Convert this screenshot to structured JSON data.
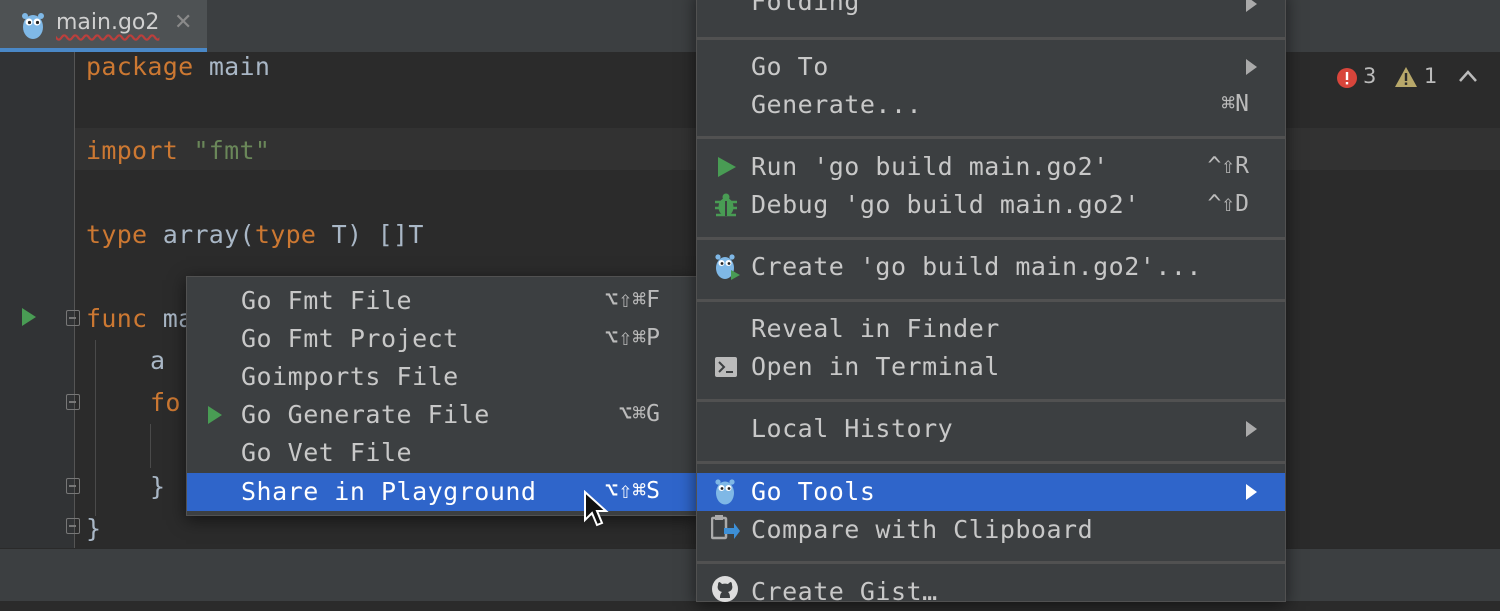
{
  "tab": {
    "filename": "main.go2",
    "close_glyph": "✕"
  },
  "editor": {
    "lines": {
      "l1_kw": "package",
      "l1_rest": " main",
      "l2_kw": "import",
      "l2_str": " \"fmt\"",
      "l3_kw1": "type",
      "l3_mid": " array(",
      "l3_kw2": "type",
      "l3_rest": " T) []T",
      "l4_kw": "func",
      "l4_rest": " ma",
      "l5": "a",
      "l6_kw": "fo",
      "l7": "}",
      "l8": "}"
    }
  },
  "inspections": {
    "errors": "3",
    "warnings": "1",
    "error_color": "#d8453b",
    "warning_color": "#b8a86a"
  },
  "submenu": {
    "items": [
      {
        "label": "Go Fmt File",
        "shortcut": "⌥⇧⌘F"
      },
      {
        "label": "Go Fmt Project",
        "shortcut": "⌥⇧⌘P"
      },
      {
        "label": "Goimports File",
        "shortcut": ""
      },
      {
        "label": "Go Generate File",
        "shortcut": "⌥⌘G",
        "icon": "run-icon"
      },
      {
        "label": "Go Vet File",
        "shortcut": ""
      },
      {
        "label": "Share in Playground",
        "shortcut": "⌥⇧⌘S",
        "selected": true
      }
    ]
  },
  "context_menu": {
    "items": [
      {
        "label": "Folding",
        "submenu": true
      },
      {
        "label": "Go To",
        "submenu": true
      },
      {
        "label": "Generate...",
        "shortcut": "⌘N"
      },
      {
        "label": "Run 'go build main.go2'",
        "shortcut": "^⇧R",
        "icon": "run-icon"
      },
      {
        "label": "Debug 'go build main.go2'",
        "shortcut": "^⇧D",
        "icon": "debug-bug-icon"
      },
      {
        "label": "Create 'go build main.go2'...",
        "icon": "gopher-run-icon"
      },
      {
        "label": "Reveal in Finder"
      },
      {
        "label": "Open in Terminal",
        "icon": "terminal-icon"
      },
      {
        "label": "Local History",
        "submenu": true
      },
      {
        "label": "Go Tools",
        "submenu": true,
        "selected": true,
        "icon": "gopher-icon"
      },
      {
        "label": "Compare with Clipboard",
        "icon": "compare-icon"
      },
      {
        "label": "Create Gist…",
        "icon": "github-icon"
      }
    ]
  },
  "colors": {
    "accent": "#2f65ca",
    "run_green": "#499c54",
    "keyword": "#cc7832",
    "string": "#6a8759",
    "text": "#a9b7c6"
  }
}
